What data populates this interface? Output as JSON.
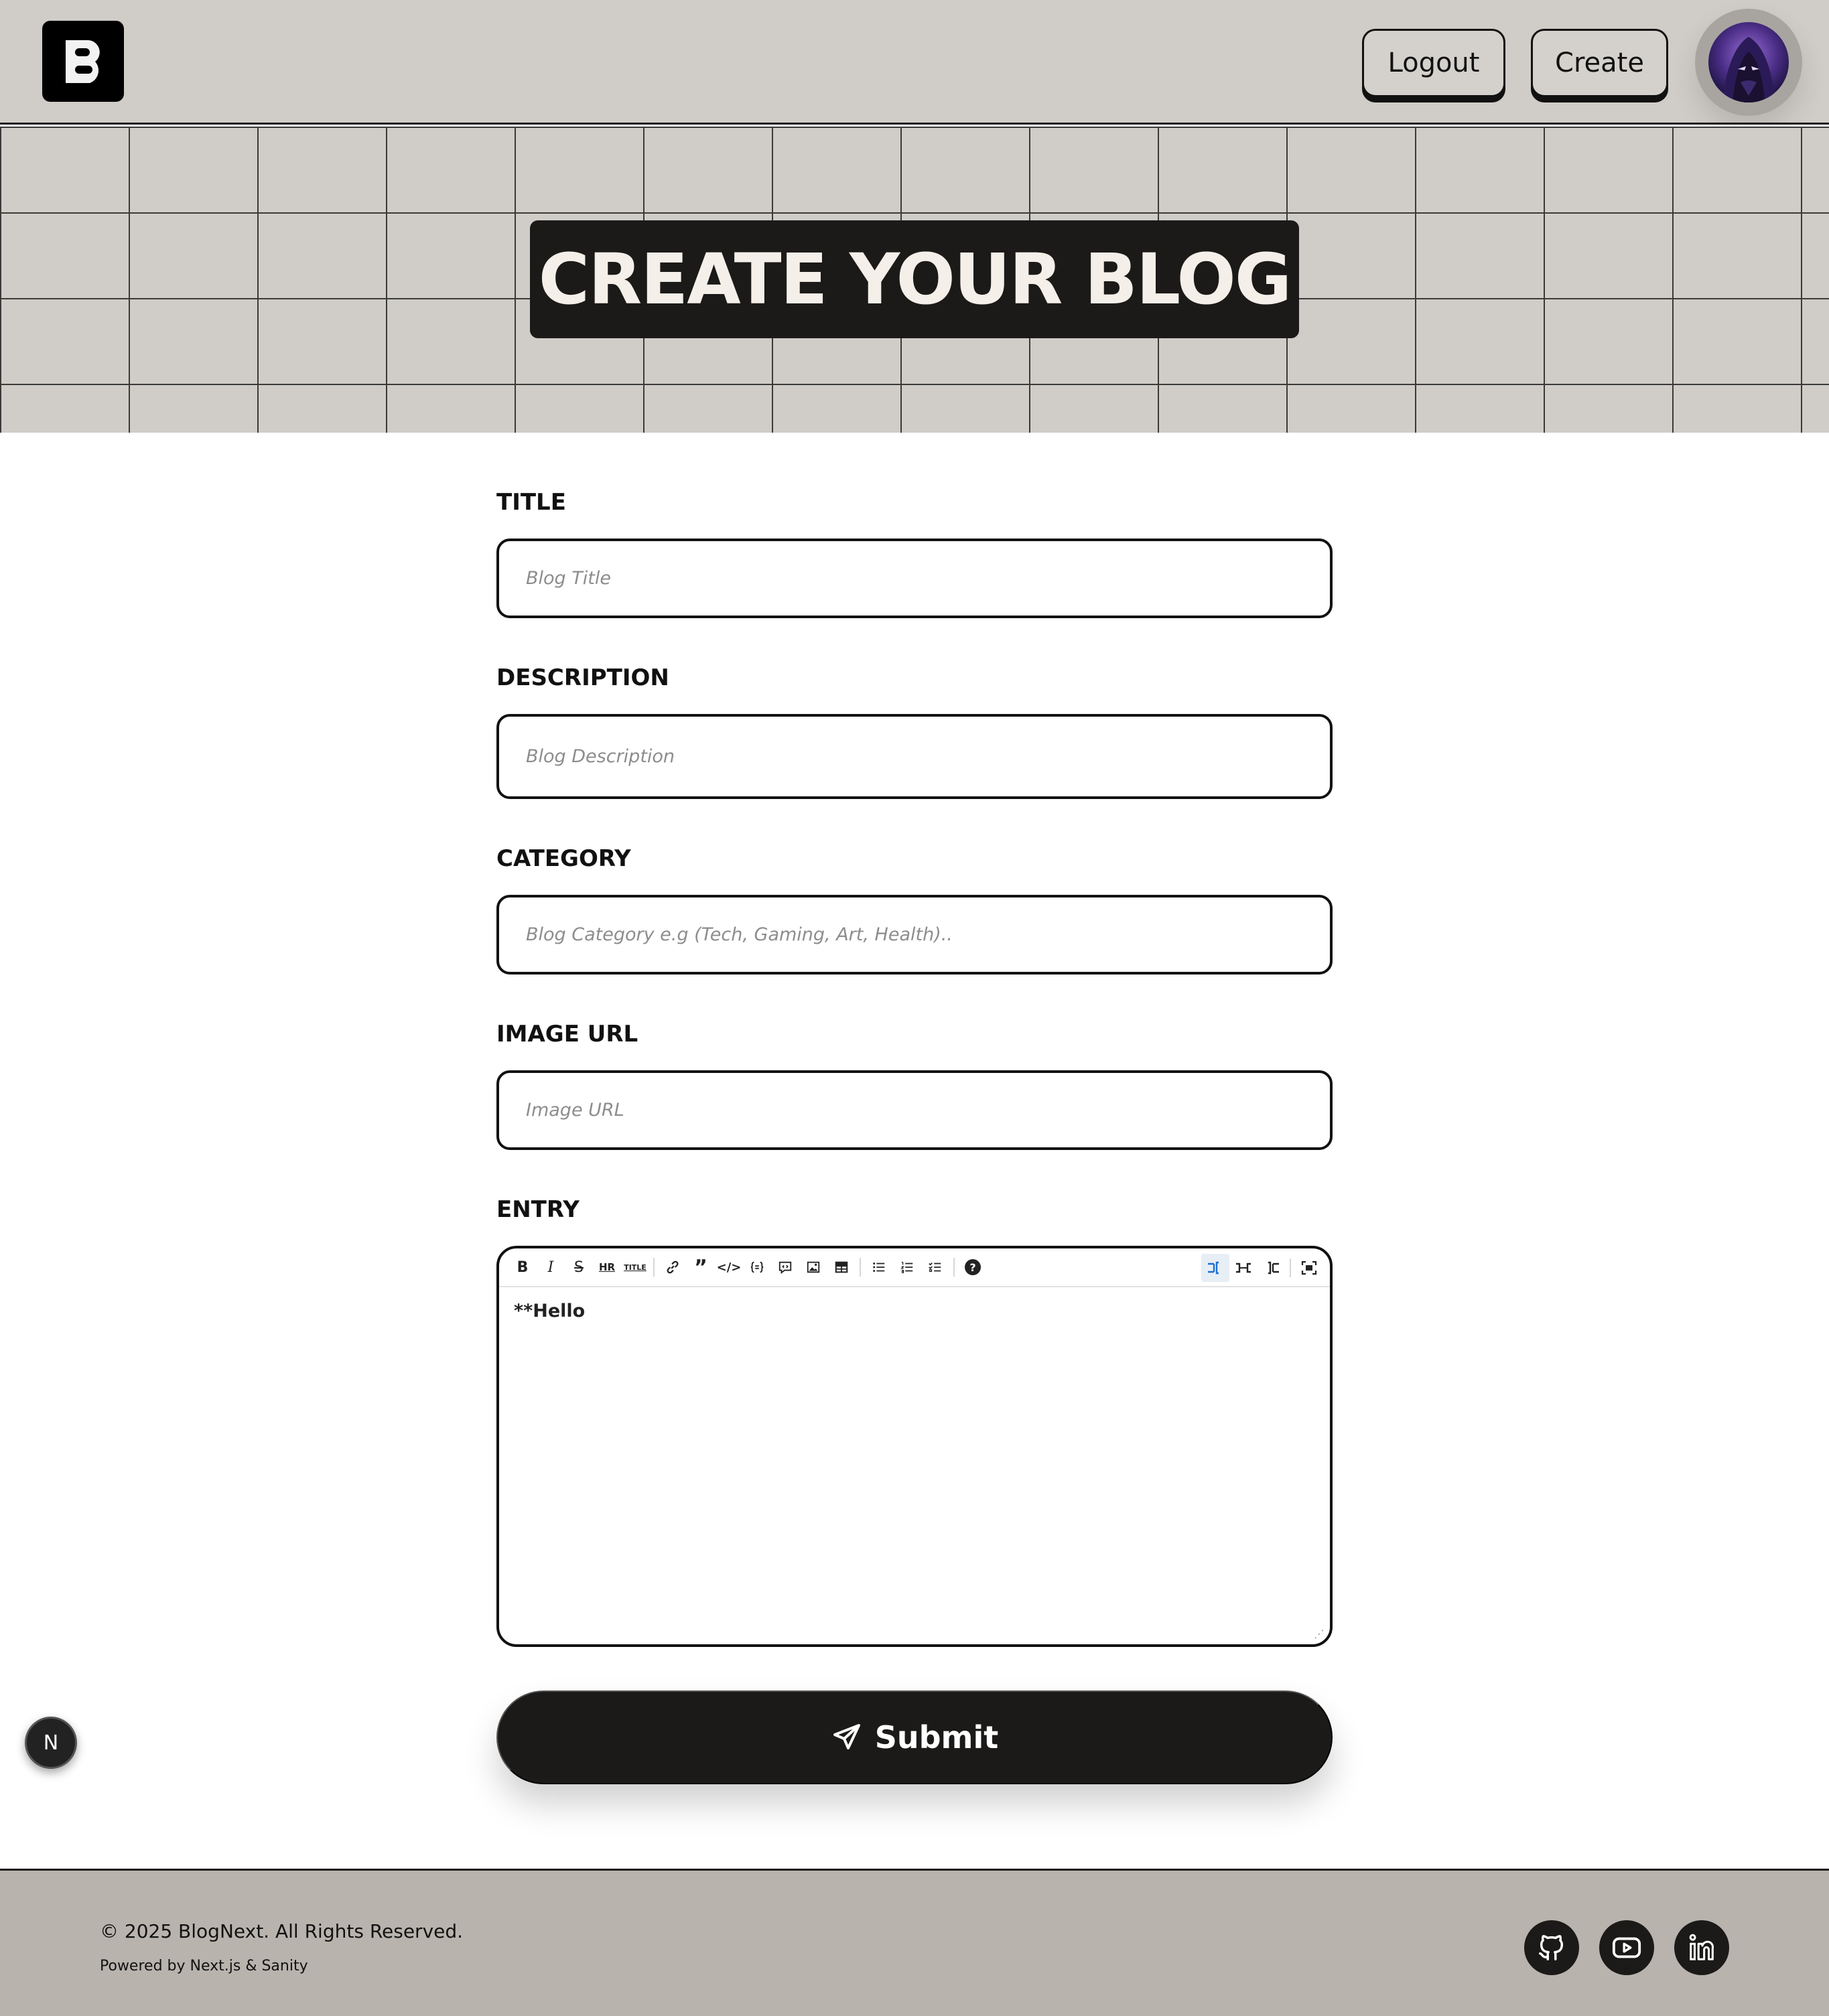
{
  "nav": {
    "logout_label": "Logout",
    "create_label": "Create"
  },
  "hero": {
    "title": "CREATE YOUR BLOG"
  },
  "form": {
    "title": {
      "label": "TITLE",
      "placeholder": "Blog Title"
    },
    "description": {
      "label": "DESCRIPTION",
      "placeholder": "Blog Description"
    },
    "category": {
      "label": "CATEGORY",
      "placeholder": "Blog Category e.g (Tech, Gaming, Art, Health).."
    },
    "image_url": {
      "label": "IMAGE URL",
      "placeholder": "Image URL"
    },
    "entry": {
      "label": "ENTRY",
      "content": "**Hello",
      "toolbar_labels": {
        "bold": "B",
        "italic": "I",
        "strike": "S",
        "hr": "HR",
        "title": "TITLE",
        "code": "</>",
        "help": "?"
      }
    },
    "submit_label": "Submit"
  },
  "next_badge": "N",
  "footer": {
    "copyright": "© 2025 BlogNext. All Rights Reserved.",
    "powered": "Powered by Next.js & Sanity"
  },
  "colors": {
    "nav_bg": "#d0cdc8",
    "dark": "#1b1a18",
    "footer_bg": "#b8b3ad",
    "accent_blue": "#1c6fd1"
  }
}
